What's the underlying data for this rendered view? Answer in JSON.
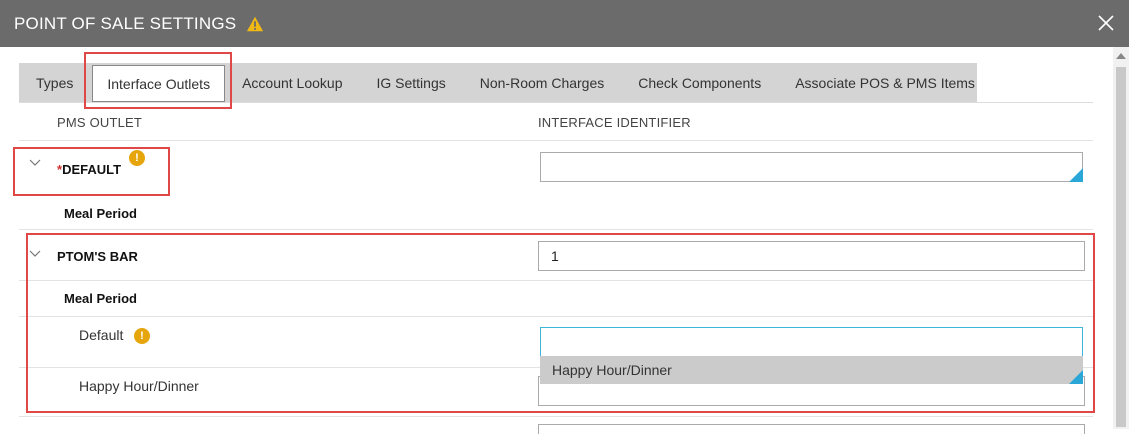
{
  "window": {
    "title": "POINT OF SALE SETTINGS",
    "title_warning_icon": "warning-triangle-icon",
    "close_icon": "close-icon"
  },
  "tabs": [
    {
      "label": "Types"
    },
    {
      "label": "Interface Outlets",
      "active": true
    },
    {
      "label": "Account Lookup"
    },
    {
      "label": "IG Settings"
    },
    {
      "label": "Non-Room Charges"
    },
    {
      "label": "Check Components"
    },
    {
      "label": "Associate POS & PMS Items"
    }
  ],
  "columns": {
    "pms_outlet": "PMS OUTLET",
    "interface_identifier": "INTERFACE IDENTIFIER"
  },
  "outlets": {
    "default": {
      "required_mark": "*",
      "name": "DEFAULT",
      "warning": "!",
      "identifier": "",
      "meal_period_label": "Meal Period"
    },
    "ptoms_bar": {
      "name": "PTOM'S BAR",
      "identifier": "1",
      "meal_period_label": "Meal Period",
      "meal_periods": [
        {
          "name": "Default",
          "warning": "!",
          "value": ""
        },
        {
          "name": "Happy Hour/Dinner",
          "value": ""
        }
      ]
    }
  },
  "dropdown": {
    "option": "Happy Hour/Dinner"
  },
  "colors": {
    "titlebar": "#6b6b6b",
    "highlight_border": "#e04848",
    "warning": "#e6a60b",
    "focus": "#3fb6d8",
    "corner_accent": "#2aa7d6"
  }
}
